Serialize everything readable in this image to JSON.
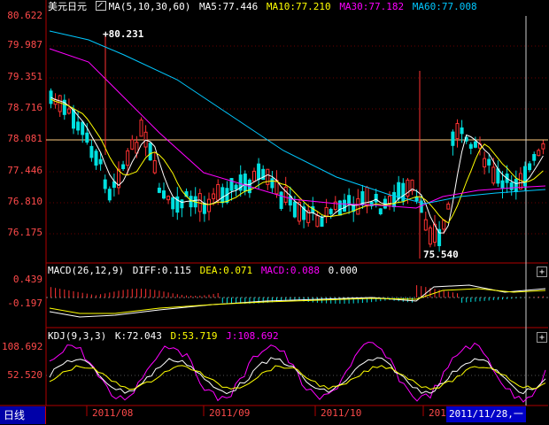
{
  "main_legend": {
    "title": "美元日元",
    "ma_label": "MA(5,10,30,60)",
    "ma5": "MA5:77.446",
    "ma10": "MA10:77.210",
    "ma30": "MA30:77.182",
    "ma60": "MA60:77.008"
  },
  "macd_legend": {
    "label": "MACD(26,12,9)",
    "diff": "DIFF:0.115",
    "dea": "DEA:0.071",
    "macd": "MACD:0.088",
    "zero": "0.000"
  },
  "kdj_legend": {
    "label": "KDJ(9,3,3)",
    "k": "K:72.043",
    "d": "D:53.719",
    "j": "J:108.692"
  },
  "main_y_ticks": [
    "80.622",
    "79.987",
    "79.351",
    "78.716",
    "78.081",
    "77.446",
    "76.810",
    "76.175"
  ],
  "macd_y_ticks": [
    "0.439",
    "-0.197"
  ],
  "kdj_y_ticks": [
    "108.692",
    "52.520"
  ],
  "x_ticks": [
    "2011/08",
    "2011/09",
    "2011/10",
    "201"
  ],
  "annotations": {
    "high": "80.231",
    "low": "75.540"
  },
  "period_tab": "日线",
  "cursor_date": "2011/11/28,一",
  "plus_button": "+",
  "colors": {
    "up": "#ff3232",
    "down": "#00e0e0",
    "ma5": "#ffffff",
    "ma10": "#ffff00",
    "ma30": "#ff00ff",
    "ma60": "#00c8ff",
    "axis": "#b00000",
    "price_line": "#ffcc80"
  },
  "chart_data": {
    "type": "candlestick",
    "ylim": [
      75.5,
      80.7
    ],
    "price_level_line": 78.081,
    "high_marker": 80.231,
    "low_marker": 75.54
  }
}
